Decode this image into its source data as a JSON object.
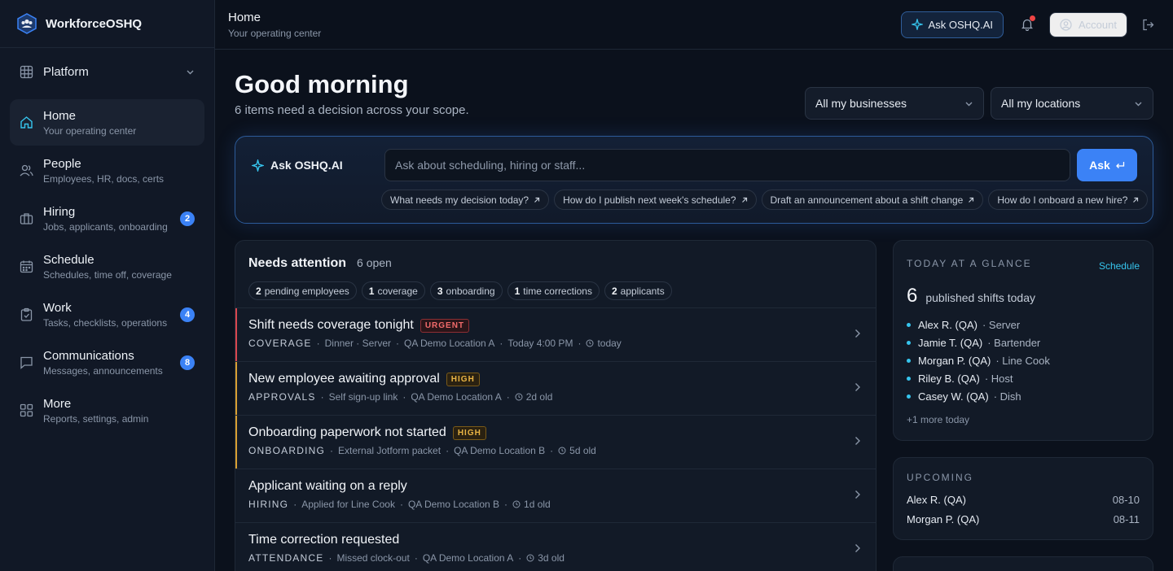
{
  "brand": {
    "name": "WorkforceOSHQ"
  },
  "platform": {
    "label": "Platform"
  },
  "nav": [
    {
      "title": "Home",
      "sub": "Your operating center",
      "badge": "",
      "icon": "home-icon"
    },
    {
      "title": "People",
      "sub": "Employees, HR, docs, certs",
      "badge": "",
      "icon": "people-icon"
    },
    {
      "title": "Hiring",
      "sub": "Jobs, applicants, onboarding",
      "badge": "2",
      "icon": "briefcase-icon"
    },
    {
      "title": "Schedule",
      "sub": "Schedules, time off, coverage",
      "badge": "",
      "icon": "calendar-icon"
    },
    {
      "title": "Work",
      "sub": "Tasks, checklists, operations",
      "badge": "4",
      "icon": "clipboard-icon"
    },
    {
      "title": "Communications",
      "sub": "Messages, announcements",
      "badge": "8",
      "icon": "message-icon"
    },
    {
      "title": "More",
      "sub": "Reports, settings, admin",
      "badge": "",
      "icon": "grid-icon"
    }
  ],
  "header": {
    "title": "Home",
    "subtitle": "Your operating center",
    "ask_label": "Ask OSHQ.AI",
    "account_label": "Account"
  },
  "greeting": {
    "title": "Good morning",
    "subtitle": "6 items need a decision across your scope."
  },
  "filters": {
    "business": "All my businesses",
    "location": "All my locations"
  },
  "ask": {
    "label": "Ask OSHQ.AI",
    "placeholder": "Ask about scheduling, hiring or staff...",
    "button": "Ask",
    "suggestions": [
      "What needs my decision today?",
      "How do I publish next week's schedule?",
      "Draft an announcement about a shift change",
      "How do I onboard a new hire?"
    ]
  },
  "attention": {
    "title": "Needs attention",
    "count": "6 open",
    "pills": [
      {
        "n": "2",
        "label": "pending employees"
      },
      {
        "n": "1",
        "label": "coverage"
      },
      {
        "n": "3",
        "label": "onboarding"
      },
      {
        "n": "1",
        "label": "time corrections"
      },
      {
        "n": "2",
        "label": "applicants"
      }
    ],
    "items": [
      {
        "title": "Shift needs coverage tonight",
        "tag": "URGENT",
        "category": "COVERAGE",
        "detail": "Dinner · Server",
        "location": "QA Demo Location A",
        "extra": "Today 4:00 PM",
        "age": "today",
        "accent": "#d9474f"
      },
      {
        "title": "New employee awaiting approval",
        "tag": "HIGH",
        "category": "APPROVALS",
        "detail": "Self sign-up link",
        "location": "QA Demo Location A",
        "extra": "",
        "age": "2d old",
        "accent": "#d9a032"
      },
      {
        "title": "Onboarding paperwork not started",
        "tag": "HIGH",
        "category": "ONBOARDING",
        "detail": "External Jotform packet",
        "location": "QA Demo Location B",
        "extra": "",
        "age": "5d old",
        "accent": "#d9a032"
      },
      {
        "title": "Applicant waiting on a reply",
        "tag": "",
        "category": "HIRING",
        "detail": "Applied for Line Cook",
        "location": "QA Demo Location B",
        "extra": "",
        "age": "1d old",
        "accent": ""
      },
      {
        "title": "Time correction requested",
        "tag": "",
        "category": "ATTENDANCE",
        "detail": "Missed clock-out",
        "location": "QA Demo Location A",
        "extra": "",
        "age": "3d old",
        "accent": ""
      }
    ]
  },
  "glance": {
    "label": "TODAY AT A GLANCE",
    "link": "Schedule",
    "count": "6",
    "count_text": "published shifts today",
    "shifts": [
      {
        "name": "Alex R. (QA)",
        "role": "· Server"
      },
      {
        "name": "Jamie T. (QA)",
        "role": "· Bartender"
      },
      {
        "name": "Morgan P. (QA)",
        "role": "· Line Cook"
      },
      {
        "name": "Riley B. (QA)",
        "role": "· Host"
      },
      {
        "name": "Casey W. (QA)",
        "role": "· Dish"
      }
    ],
    "more": "+1 more today"
  },
  "upcoming": {
    "label": "UPCOMING",
    "rows": [
      {
        "name": "Alex R. (QA)",
        "date": "08-10"
      },
      {
        "name": "Morgan P. (QA)",
        "date": "08-11"
      }
    ]
  },
  "colors": {
    "accent": "#3b82f6",
    "cyan": "#36c5ee",
    "urgent": "#d9474f",
    "high": "#d9a032"
  }
}
